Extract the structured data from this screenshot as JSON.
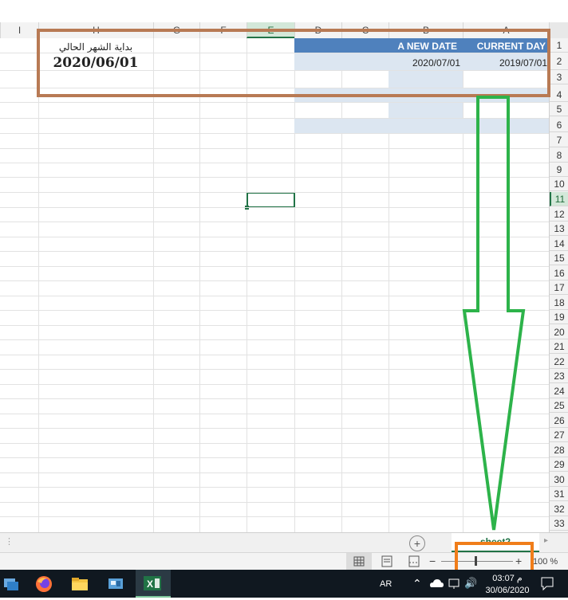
{
  "columns": [
    "I",
    "H",
    "G",
    "F",
    "E",
    "D",
    "C",
    "B",
    "A"
  ],
  "selected_column": "E",
  "rows": [
    "1",
    "2",
    "3",
    "4",
    "5",
    "6",
    "7",
    "8",
    "9",
    "10",
    "11",
    "12",
    "13",
    "14",
    "15",
    "16",
    "17",
    "18",
    "19",
    "20",
    "21",
    "22",
    "23",
    "24",
    "25",
    "26",
    "27",
    "28",
    "29",
    "30",
    "31",
    "32",
    "33"
  ],
  "selected_row": "11",
  "table": {
    "header_new_date": "A NEW DATE",
    "header_current_day": "CURRENT DAY",
    "new_date_value": "2020/07/01",
    "current_day_value": "2019/07/01"
  },
  "arabic_label": "بداية الشهر الحالي",
  "big_date": "2020/06/01",
  "sheet_tab": "sheet2",
  "zoom": "100 %",
  "taskbar": {
    "language": "AR",
    "time": "03:07 م",
    "date": "30/06/2020"
  },
  "colors": {
    "annotation_brown": "#b87a54",
    "annotation_orange": "#f07d1a",
    "arrow_green": "#2db34a",
    "excel_green": "#217346",
    "table_header_blue": "#4f81bd",
    "table_band": "#dce6f1"
  }
}
